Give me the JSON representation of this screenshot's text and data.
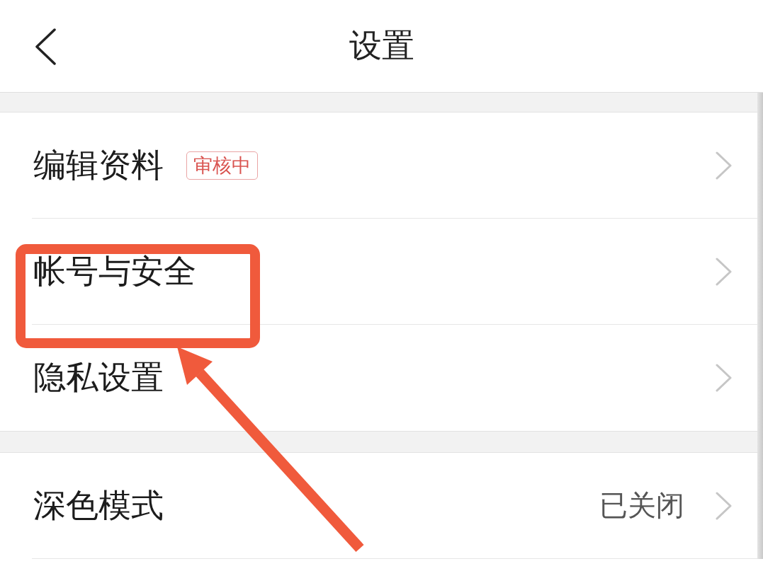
{
  "header": {
    "title": "设置"
  },
  "sections": [
    {
      "items": [
        {
          "label": "编辑资料",
          "badge": "审核中"
        },
        {
          "label": "帐号与安全"
        },
        {
          "label": "隐私设置"
        }
      ]
    },
    {
      "items": [
        {
          "label": "深色模式",
          "value": "已关闭"
        }
      ]
    }
  ]
}
